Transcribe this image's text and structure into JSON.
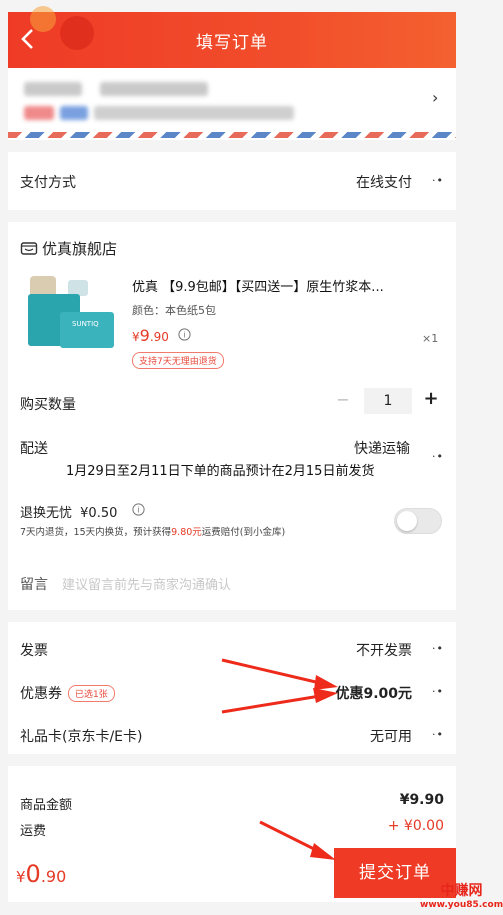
{
  "header": {
    "title": "填写订单"
  },
  "payment": {
    "label": "支付方式",
    "value": "在线支付"
  },
  "shop": {
    "name": "优真旗舰店"
  },
  "product": {
    "title": "优真 【9.9包邮】【买四送一】原生竹浆本...",
    "variant": "颜色：本色纸5包",
    "price_symbol": "¥",
    "price_int": "9",
    "price_dec": ".90",
    "return_tag": "支持7天无理由退货",
    "quantity_mark": "×1",
    "package_text": "SUNTIQ"
  },
  "quantity": {
    "label": "购买数量",
    "minus": "−",
    "value": "1",
    "plus": "+"
  },
  "delivery": {
    "label": "配送",
    "method": "快递运输",
    "note": "1月29日至2月11日下单的商品预计在2月15日前发货"
  },
  "return_insurance": {
    "label": "退换无忧",
    "price": "¥0.50",
    "desc_prefix": "7天内退货，15天内换货，预计获得",
    "desc_highlight": "9.80元",
    "desc_suffix": "运费赔付(到小金库)"
  },
  "remark": {
    "label": "留言",
    "placeholder": "建议留言前先与商家沟通确认"
  },
  "invoice": {
    "label": "发票",
    "value": "不开发票"
  },
  "coupon": {
    "label": "优惠券",
    "badge": "已选1张",
    "value": "优惠9.00元"
  },
  "giftcard": {
    "label": "礼品卡(京东卡/E卡)",
    "value": "无可用"
  },
  "summary": {
    "goods_label": "商品金额",
    "goods_value": "¥9.90",
    "shipping_label": "运费",
    "shipping_value": "+ ¥0.00"
  },
  "footer": {
    "total_symbol": "¥",
    "total_int": "0",
    "total_dec": ".90",
    "submit": "提交订单"
  },
  "watermark": {
    "line1": "中赚网",
    "line2": "www.you85.com"
  },
  "icons": {
    "back": "chevron-left-icon",
    "more": "more-dots-icon",
    "info": "info-icon",
    "shop": "shop-icon"
  },
  "colors": {
    "accent": "#ef3b26",
    "price": "#e53a26",
    "arrow": "#ee2a1a"
  }
}
